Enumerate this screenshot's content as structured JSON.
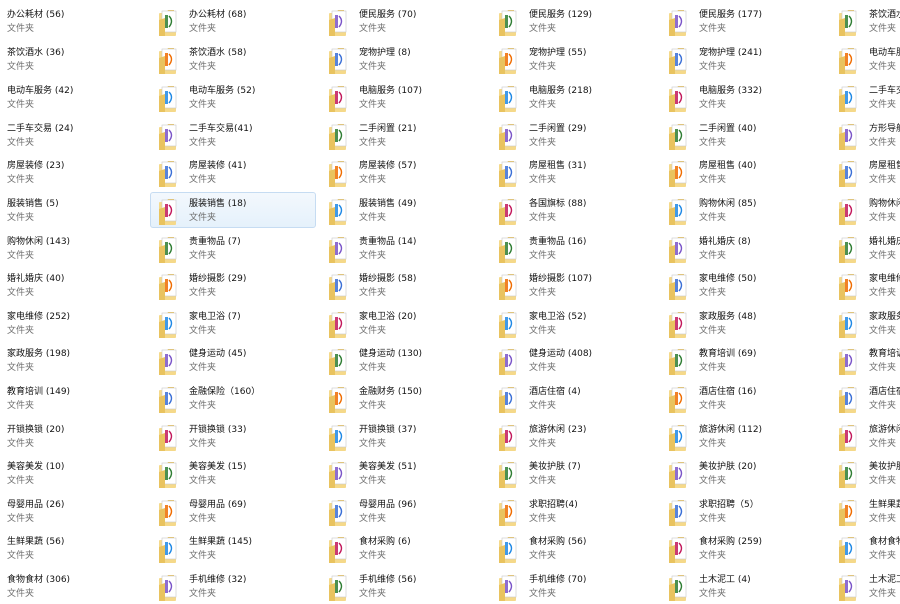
{
  "view": "content-view-folder-grid",
  "item_type_label": "文件夹",
  "colors": {
    "selection_bg": "#e5f1fb",
    "selection_border": "#c6dcf2",
    "folder_body": "#f5d98a",
    "folder_tab": "#e9c35f",
    "paper": "#ffffff"
  },
  "selected_column": 1,
  "selected_row": 5,
  "columns": [
    {
      "items": [
        {
          "name": "办公耗材 (56)",
          "icon": "folder-icon"
        },
        {
          "name": "茶饮酒水 (36)",
          "icon": "folder-icon"
        },
        {
          "name": "电动车服务 (42)",
          "icon": "folder-icon"
        },
        {
          "name": "二手车交易 (24)",
          "icon": "folder-icon"
        },
        {
          "name": "房屋装修 (23)",
          "icon": "folder-icon"
        },
        {
          "name": "服装销售 (5)",
          "icon": "folder-icon"
        },
        {
          "name": "购物休闲 (143)",
          "icon": "folder-icon"
        },
        {
          "name": "婚礼婚庆 (40)",
          "icon": "folder-icon"
        },
        {
          "name": "家电维修 (252)",
          "icon": "folder-icon"
        },
        {
          "name": "家政服务 (198)",
          "icon": "folder-icon"
        },
        {
          "name": "教育培训 (149)",
          "icon": "folder-icon"
        },
        {
          "name": "开锁换锁 (20)",
          "icon": "folder-icon"
        },
        {
          "name": "美容美发 (10)",
          "icon": "folder-icon"
        },
        {
          "name": "母婴用品 (26)",
          "icon": "folder-icon"
        },
        {
          "name": "生鲜果蔬 (56)",
          "icon": "folder-icon"
        },
        {
          "name": "食物食材 (306)",
          "icon": "folder-icon"
        }
      ]
    },
    {
      "items": [
        {
          "name": "办公耗材 (68)",
          "icon": "folder-icon"
        },
        {
          "name": "茶饮酒水 (58)",
          "icon": "folder-icon"
        },
        {
          "name": "电动车服务 (52)",
          "icon": "folder-icon"
        },
        {
          "name": "二手车交易(41)",
          "icon": "folder-icon"
        },
        {
          "name": "房屋装修 (41)",
          "icon": "folder-icon"
        },
        {
          "name": "服装销售 (18)",
          "icon": "folder-icon"
        },
        {
          "name": "贵重物品 (7)",
          "icon": "folder-icon"
        },
        {
          "name": "婚纱摄影 (29)",
          "icon": "folder-icon"
        },
        {
          "name": "家电卫浴 (7)",
          "icon": "folder-icon"
        },
        {
          "name": "健身运动 (45)",
          "icon": "folder-icon"
        },
        {
          "name": "金融保险（160）",
          "icon": "folder-icon"
        },
        {
          "name": "开锁换锁 (33)",
          "icon": "folder-icon"
        },
        {
          "name": "美容美发 (15)",
          "icon": "folder-icon"
        },
        {
          "name": "母婴用品 (69)",
          "icon": "folder-icon"
        },
        {
          "name": "生鲜果蔬 (145)",
          "icon": "folder-icon"
        },
        {
          "name": "手机维修 (32)",
          "icon": "folder-icon"
        }
      ]
    },
    {
      "items": [
        {
          "name": "便民服务 (70)",
          "icon": "folder-icon"
        },
        {
          "name": "宠物护理 (8)",
          "icon": "folder-icon"
        },
        {
          "name": "电脑服务 (107)",
          "icon": "folder-icon"
        },
        {
          "name": "二手闲置 (21)",
          "icon": "folder-icon"
        },
        {
          "name": "房屋装修 (57)",
          "icon": "folder-icon"
        },
        {
          "name": "服装销售 (49)",
          "icon": "folder-icon"
        },
        {
          "name": "贵重物品 (14)",
          "icon": "folder-icon"
        },
        {
          "name": "婚纱摄影 (58)",
          "icon": "folder-icon"
        },
        {
          "name": "家电卫浴 (20)",
          "icon": "folder-icon"
        },
        {
          "name": "健身运动 (130)",
          "icon": "folder-icon"
        },
        {
          "name": "金融财务 (150)",
          "icon": "folder-icon"
        },
        {
          "name": "开锁换锁 (37)",
          "icon": "folder-icon"
        },
        {
          "name": "美容美发 (51)",
          "icon": "folder-icon"
        },
        {
          "name": "母婴用品 (96)",
          "icon": "folder-icon"
        },
        {
          "name": "食材采购 (6)",
          "icon": "folder-icon"
        },
        {
          "name": "手机维修 (56)",
          "icon": "folder-icon"
        }
      ]
    },
    {
      "items": [
        {
          "name": "便民服务 (129)",
          "icon": "folder-icon"
        },
        {
          "name": "宠物护理 (55)",
          "icon": "folder-icon"
        },
        {
          "name": "电脑服务 (218)",
          "icon": "folder-icon"
        },
        {
          "name": "二手闲置 (29)",
          "icon": "folder-icon"
        },
        {
          "name": "房屋租售 (31)",
          "icon": "folder-icon"
        },
        {
          "name": "各国旗标 (88)",
          "icon": "folder-icon"
        },
        {
          "name": "贵重物品 (16)",
          "icon": "folder-icon"
        },
        {
          "name": "婚纱摄影 (107)",
          "icon": "folder-icon"
        },
        {
          "name": "家电卫浴 (52)",
          "icon": "folder-icon"
        },
        {
          "name": "健身运动 (408)",
          "icon": "folder-icon"
        },
        {
          "name": "酒店住宿 (4)",
          "icon": "folder-icon"
        },
        {
          "name": "旅游休闲 (23)",
          "icon": "folder-icon"
        },
        {
          "name": "美妆护肤 (7)",
          "icon": "folder-icon"
        },
        {
          "name": "求职招聘(4)",
          "icon": "folder-icon"
        },
        {
          "name": "食材采购 (56)",
          "icon": "folder-icon"
        },
        {
          "name": "手机维修 (70)",
          "icon": "folder-icon"
        }
      ]
    },
    {
      "items": [
        {
          "name": "便民服务 (177)",
          "icon": "folder-icon"
        },
        {
          "name": "宠物护理 (241)",
          "icon": "folder-icon"
        },
        {
          "name": "电脑服务 (332)",
          "icon": "folder-icon"
        },
        {
          "name": "二手闲置 (40)",
          "icon": "folder-icon"
        },
        {
          "name": "房屋租售 (40)",
          "icon": "folder-icon"
        },
        {
          "name": "购物休闲 (85)",
          "icon": "folder-icon"
        },
        {
          "name": "婚礼婚庆 (8)",
          "icon": "folder-icon"
        },
        {
          "name": "家电维修 (50)",
          "icon": "folder-icon"
        },
        {
          "name": "家政服务 (48)",
          "icon": "folder-icon"
        },
        {
          "name": "教育培训 (69)",
          "icon": "folder-icon"
        },
        {
          "name": "酒店住宿 (16)",
          "icon": "folder-icon"
        },
        {
          "name": "旅游休闲 (112)",
          "icon": "folder-icon"
        },
        {
          "name": "美妆护肤 (20)",
          "icon": "folder-icon"
        },
        {
          "name": "求职招聘（5）",
          "icon": "folder-icon"
        },
        {
          "name": "食材采购 (259)",
          "icon": "folder-icon"
        },
        {
          "name": "土木泥工 (4)",
          "icon": "folder-icon"
        }
      ]
    },
    {
      "items": [
        {
          "name": "茶饮酒水",
          "icon": "folder-icon"
        },
        {
          "name": "电动车服",
          "icon": "folder-icon"
        },
        {
          "name": "二手车交",
          "icon": "folder-icon"
        },
        {
          "name": "方形导航",
          "icon": "folder-icon"
        },
        {
          "name": "房屋租售",
          "icon": "folder-icon"
        },
        {
          "name": "购物休闲",
          "icon": "folder-icon"
        },
        {
          "name": "婚礼婚庆",
          "icon": "folder-icon"
        },
        {
          "name": "家电维修",
          "icon": "folder-icon"
        },
        {
          "name": "家政服务",
          "icon": "folder-icon"
        },
        {
          "name": "教育培训",
          "icon": "folder-icon"
        },
        {
          "name": "酒店住宿",
          "icon": "folder-icon"
        },
        {
          "name": "旅游休闲",
          "icon": "folder-icon"
        },
        {
          "name": "美妆护肤",
          "icon": "folder-icon"
        },
        {
          "name": "生鲜果蔬",
          "icon": "folder-icon"
        },
        {
          "name": "食材食物",
          "icon": "folder-icon"
        },
        {
          "name": "土木泥工",
          "icon": "folder-icon"
        }
      ]
    }
  ]
}
